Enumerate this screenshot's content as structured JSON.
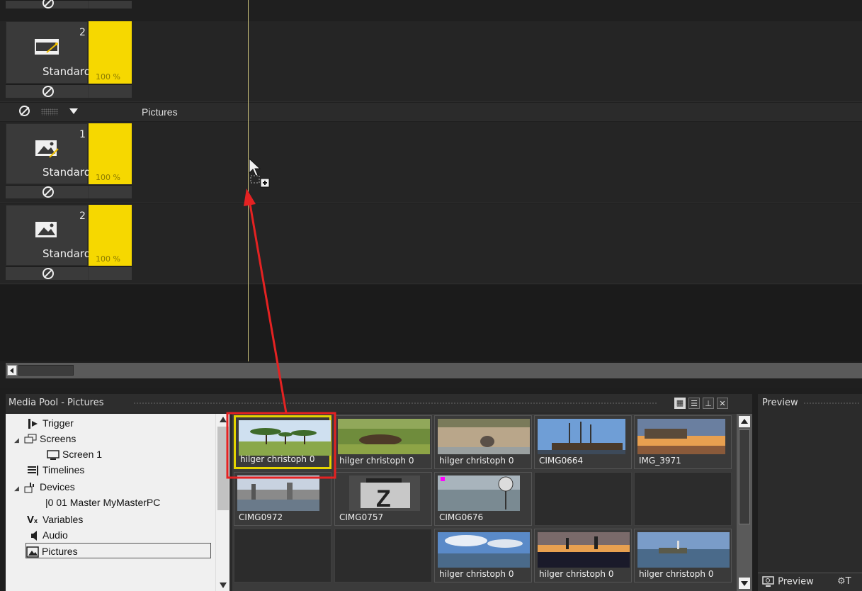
{
  "timeline": {
    "tracks": [
      {
        "number": "2",
        "mode": "Standard",
        "opacity": "100 %",
        "type": "video"
      },
      {
        "number": "1",
        "mode": "Standard",
        "opacity": "100 %",
        "type": "picture"
      },
      {
        "number": "2",
        "mode": "Standard",
        "opacity": "100 %",
        "type": "picture"
      }
    ],
    "group_label": "Pictures"
  },
  "media_pool": {
    "title": "Media Pool - Pictures",
    "tree": [
      {
        "label": "Trigger",
        "icon": "trigger-icon"
      },
      {
        "label": "Screens",
        "icon": "screens-icon"
      },
      {
        "label": "Screen 1",
        "icon": "screen-icon"
      },
      {
        "label": "Timelines",
        "icon": "timelines-icon"
      },
      {
        "label": "Devices",
        "icon": "devices-icon"
      },
      {
        "label": "|0 01 Master MyMasterPC",
        "icon": "device-icon"
      },
      {
        "label": "Variables",
        "icon": "variables-icon"
      },
      {
        "label": "Audio",
        "icon": "audio-icon"
      },
      {
        "label": "Pictures",
        "icon": "pictures-icon"
      }
    ],
    "tiles": [
      {
        "caption": "hilger christoph 0"
      },
      {
        "caption": "hilger christoph 0"
      },
      {
        "caption": "hilger christoph 0"
      },
      {
        "caption": "CIMG0664"
      },
      {
        "caption": "IMG_3971"
      },
      {
        "caption": "CIMG0972"
      },
      {
        "caption": "CIMG0757"
      },
      {
        "caption": "CIMG0676"
      },
      {
        "caption": ""
      },
      {
        "caption": ""
      },
      {
        "caption": ""
      },
      {
        "caption": ""
      },
      {
        "caption": "hilger christoph 0"
      },
      {
        "caption": "hilger christoph 0"
      },
      {
        "caption": "hilger christoph 0"
      }
    ]
  },
  "preview": {
    "title": "Preview",
    "tab_label": "Preview",
    "tab2_label": "T"
  },
  "colors": {
    "opacity_bar": "#f6d800",
    "annotation": "#e52222",
    "selection": "#e5d400"
  }
}
